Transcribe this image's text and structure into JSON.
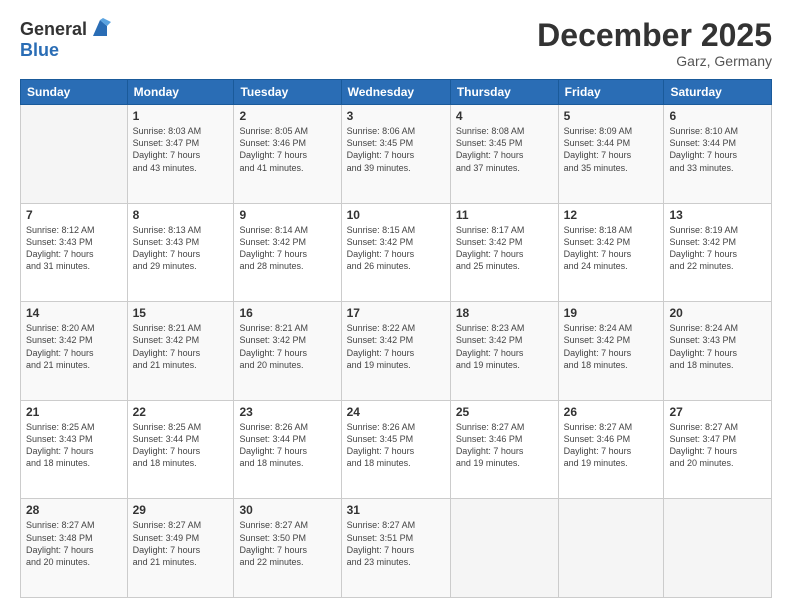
{
  "header": {
    "logo_general": "General",
    "logo_blue": "Blue",
    "month_title": "December 2025",
    "location": "Garz, Germany"
  },
  "days_of_week": [
    "Sunday",
    "Monday",
    "Tuesday",
    "Wednesday",
    "Thursday",
    "Friday",
    "Saturday"
  ],
  "weeks": [
    [
      {
        "day": "",
        "info": ""
      },
      {
        "day": "1",
        "info": "Sunrise: 8:03 AM\nSunset: 3:47 PM\nDaylight: 7 hours\nand 43 minutes."
      },
      {
        "day": "2",
        "info": "Sunrise: 8:05 AM\nSunset: 3:46 PM\nDaylight: 7 hours\nand 41 minutes."
      },
      {
        "day": "3",
        "info": "Sunrise: 8:06 AM\nSunset: 3:45 PM\nDaylight: 7 hours\nand 39 minutes."
      },
      {
        "day": "4",
        "info": "Sunrise: 8:08 AM\nSunset: 3:45 PM\nDaylight: 7 hours\nand 37 minutes."
      },
      {
        "day": "5",
        "info": "Sunrise: 8:09 AM\nSunset: 3:44 PM\nDaylight: 7 hours\nand 35 minutes."
      },
      {
        "day": "6",
        "info": "Sunrise: 8:10 AM\nSunset: 3:44 PM\nDaylight: 7 hours\nand 33 minutes."
      }
    ],
    [
      {
        "day": "7",
        "info": "Sunrise: 8:12 AM\nSunset: 3:43 PM\nDaylight: 7 hours\nand 31 minutes."
      },
      {
        "day": "8",
        "info": "Sunrise: 8:13 AM\nSunset: 3:43 PM\nDaylight: 7 hours\nand 29 minutes."
      },
      {
        "day": "9",
        "info": "Sunrise: 8:14 AM\nSunset: 3:42 PM\nDaylight: 7 hours\nand 28 minutes."
      },
      {
        "day": "10",
        "info": "Sunrise: 8:15 AM\nSunset: 3:42 PM\nDaylight: 7 hours\nand 26 minutes."
      },
      {
        "day": "11",
        "info": "Sunrise: 8:17 AM\nSunset: 3:42 PM\nDaylight: 7 hours\nand 25 minutes."
      },
      {
        "day": "12",
        "info": "Sunrise: 8:18 AM\nSunset: 3:42 PM\nDaylight: 7 hours\nand 24 minutes."
      },
      {
        "day": "13",
        "info": "Sunrise: 8:19 AM\nSunset: 3:42 PM\nDaylight: 7 hours\nand 22 minutes."
      }
    ],
    [
      {
        "day": "14",
        "info": "Sunrise: 8:20 AM\nSunset: 3:42 PM\nDaylight: 7 hours\nand 21 minutes."
      },
      {
        "day": "15",
        "info": "Sunrise: 8:21 AM\nSunset: 3:42 PM\nDaylight: 7 hours\nand 21 minutes."
      },
      {
        "day": "16",
        "info": "Sunrise: 8:21 AM\nSunset: 3:42 PM\nDaylight: 7 hours\nand 20 minutes."
      },
      {
        "day": "17",
        "info": "Sunrise: 8:22 AM\nSunset: 3:42 PM\nDaylight: 7 hours\nand 19 minutes."
      },
      {
        "day": "18",
        "info": "Sunrise: 8:23 AM\nSunset: 3:42 PM\nDaylight: 7 hours\nand 19 minutes."
      },
      {
        "day": "19",
        "info": "Sunrise: 8:24 AM\nSunset: 3:42 PM\nDaylight: 7 hours\nand 18 minutes."
      },
      {
        "day": "20",
        "info": "Sunrise: 8:24 AM\nSunset: 3:43 PM\nDaylight: 7 hours\nand 18 minutes."
      }
    ],
    [
      {
        "day": "21",
        "info": "Sunrise: 8:25 AM\nSunset: 3:43 PM\nDaylight: 7 hours\nand 18 minutes."
      },
      {
        "day": "22",
        "info": "Sunrise: 8:25 AM\nSunset: 3:44 PM\nDaylight: 7 hours\nand 18 minutes."
      },
      {
        "day": "23",
        "info": "Sunrise: 8:26 AM\nSunset: 3:44 PM\nDaylight: 7 hours\nand 18 minutes."
      },
      {
        "day": "24",
        "info": "Sunrise: 8:26 AM\nSunset: 3:45 PM\nDaylight: 7 hours\nand 18 minutes."
      },
      {
        "day": "25",
        "info": "Sunrise: 8:27 AM\nSunset: 3:46 PM\nDaylight: 7 hours\nand 19 minutes."
      },
      {
        "day": "26",
        "info": "Sunrise: 8:27 AM\nSunset: 3:46 PM\nDaylight: 7 hours\nand 19 minutes."
      },
      {
        "day": "27",
        "info": "Sunrise: 8:27 AM\nSunset: 3:47 PM\nDaylight: 7 hours\nand 20 minutes."
      }
    ],
    [
      {
        "day": "28",
        "info": "Sunrise: 8:27 AM\nSunset: 3:48 PM\nDaylight: 7 hours\nand 20 minutes."
      },
      {
        "day": "29",
        "info": "Sunrise: 8:27 AM\nSunset: 3:49 PM\nDaylight: 7 hours\nand 21 minutes."
      },
      {
        "day": "30",
        "info": "Sunrise: 8:27 AM\nSunset: 3:50 PM\nDaylight: 7 hours\nand 22 minutes."
      },
      {
        "day": "31",
        "info": "Sunrise: 8:27 AM\nSunset: 3:51 PM\nDaylight: 7 hours\nand 23 minutes."
      },
      {
        "day": "",
        "info": ""
      },
      {
        "day": "",
        "info": ""
      },
      {
        "day": "",
        "info": ""
      }
    ]
  ]
}
